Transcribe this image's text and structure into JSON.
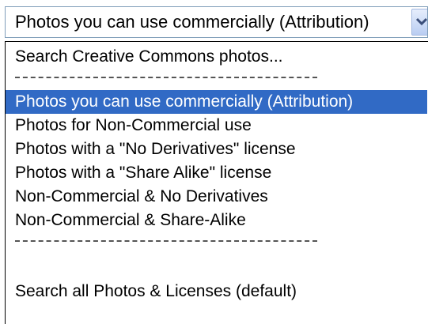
{
  "select": {
    "value": "Photos you can use commercially (Attribution)"
  },
  "dropdown": {
    "options": [
      {
        "label": "Search Creative Commons photos..."
      },
      {
        "label": "Photos you can use commercially (Attribution)",
        "selected": true
      },
      {
        "label": "Photos for Non-Commercial use"
      },
      {
        "label": "Photos with a \"No Derivatives\" license"
      },
      {
        "label": "Photos with a \"Share Alike\" license"
      },
      {
        "label": "Non-Commercial & No Derivatives"
      },
      {
        "label": "Non-Commercial & Share-Alike"
      },
      {
        "label": "Search all Photos & Licenses (default)"
      }
    ]
  },
  "colors": {
    "selection_bg": "#316ac5",
    "selection_text": "#ffffff",
    "border": "#7f9db9"
  },
  "icons": {
    "dropdown_arrow": "chevron-down-icon"
  }
}
